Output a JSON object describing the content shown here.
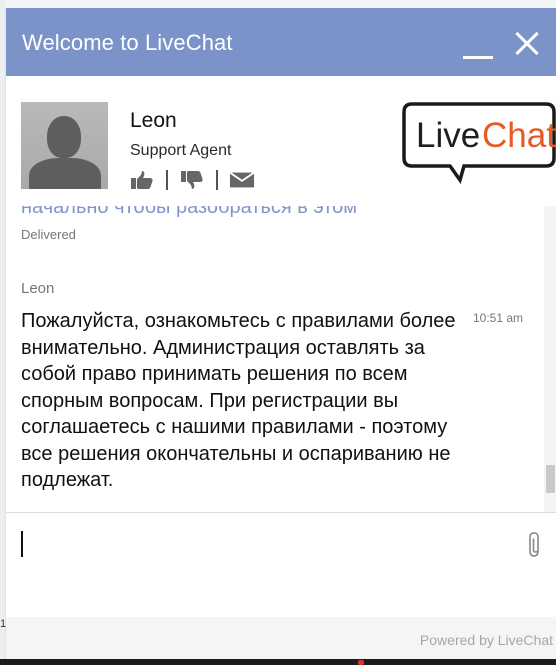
{
  "titlebar": {
    "title": "Welcome to LiveChat",
    "color": "#7b93c9"
  },
  "agent": {
    "name": "Leon",
    "role": "Support Agent"
  },
  "logo": {
    "text_live": "Live",
    "text_chat": "Chat",
    "accent": "#e85a22"
  },
  "messages": {
    "previous_cut_text": "начально чтобы разобраться в этом",
    "delivered": "Delivered",
    "last": {
      "author": "Leon",
      "time": "10:51 am",
      "text": "Пожалуйста, ознакомьтесь с правилами более внимательно. Администрация оставлять за собой право принимать решения по всем спорным вопросам. При регистрации вы соглашаетесь с нашими правилами - поэтому все решения окончательны и оспариванию не подлежат."
    }
  },
  "input": {
    "value": "",
    "placeholder": ""
  },
  "icons": {
    "thumbs_up": "thumbs-up-icon",
    "thumbs_down": "thumbs-down-icon",
    "email": "envelope-icon",
    "attach": "paperclip-icon",
    "minimize": "minimize-icon",
    "close": "close-icon"
  },
  "footer": {
    "powered_by": "Powered by LiveChat"
  }
}
